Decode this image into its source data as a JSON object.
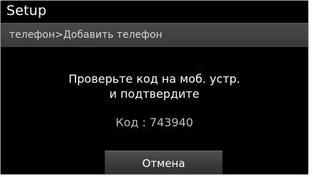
{
  "header": {
    "title": "Setup"
  },
  "breadcrumb": {
    "text": "телефон>Добавить телефон"
  },
  "dialog": {
    "message_line1": "Проверьте код на моб. устр.",
    "message_line2": "и подтвердите",
    "code_label": "Код",
    "code_separator": " : ",
    "code_value": "743940",
    "cancel_label": "Отмена"
  },
  "colors": {
    "background": "#000000",
    "bar": "#404040",
    "text": "#ffffff",
    "secondary_text": "#bdbdbd"
  }
}
